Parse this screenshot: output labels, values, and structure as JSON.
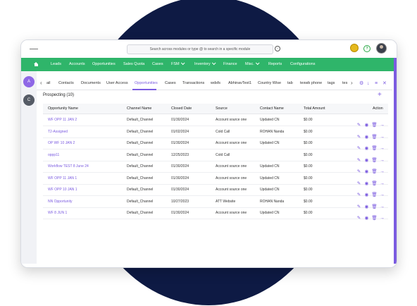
{
  "search": {
    "placeholder": "Search across modules or type @ to search in a specific module"
  },
  "nav": {
    "items": [
      {
        "label": "Leads"
      },
      {
        "label": "Accounts"
      },
      {
        "label": "Opportunities"
      },
      {
        "label": "Sales Quota"
      },
      {
        "label": "Cases"
      },
      {
        "label": "FSM"
      },
      {
        "label": "Inventory"
      },
      {
        "label": "Finance"
      },
      {
        "label": "Misc."
      },
      {
        "label": "Reports"
      },
      {
        "label": "Configurations"
      }
    ]
  },
  "sidebar": {
    "a": "A",
    "c": "C"
  },
  "tabs": [
    {
      "label": "ail"
    },
    {
      "label": "Contacts"
    },
    {
      "label": "Documents"
    },
    {
      "label": "User Access"
    },
    {
      "label": "Opportunities"
    },
    {
      "label": "Cases"
    },
    {
      "label": "Transactions"
    },
    {
      "label": "wdsfs"
    },
    {
      "label": "AbhinavTest1"
    },
    {
      "label": "Country Wise"
    },
    {
      "label": "tab"
    },
    {
      "label": "teswb phone"
    },
    {
      "label": "tags"
    },
    {
      "label": "tes"
    }
  ],
  "section": {
    "title": "Prospecting (10)"
  },
  "table": {
    "headers": [
      "Opportunity Name",
      "Channel Name",
      "Closed Date",
      "Source",
      "Contact Name",
      "Total Amount",
      "Action"
    ],
    "rows": [
      [
        "WF OPP 11 JAN 2",
        "Default_Channel",
        "01/30/2024",
        "Account source one",
        "Updated CN",
        "$0.00"
      ],
      [
        "T2-Assigned",
        "Default_Channel",
        "01/02/2024",
        "Cold Call",
        "ROHAN Nanda",
        "$0.00"
      ],
      [
        "OP WF 10 JAN 2",
        "Default_Channel",
        "01/30/2024",
        "Account source one",
        "Updated CN",
        "$0.00"
      ],
      [
        "oppp11",
        "Default_Channel",
        "12/25/2023",
        "Cold Call",
        "",
        "$0.00"
      ],
      [
        "Workflow TEST 8 June 24",
        "Default_Channel",
        "01/30/2024",
        "Account source one",
        "Updated CN",
        "$0.00"
      ],
      [
        "WF OPP 11 JAN 1",
        "Default_Channel",
        "01/30/2024",
        "Account source one",
        "Updated CN",
        "$0.00"
      ],
      [
        "WF OPP 10 JAN 1",
        "Default_Channel",
        "01/30/2024",
        "Account source one",
        "Updated CN",
        "$0.00"
      ],
      [
        "NN Opportunity",
        "Default_Channel",
        "10/27/2023",
        "ATT Website",
        "ROHAN Nanda",
        "$0.00"
      ],
      [
        "WF 8 JUN 1",
        "Default_Channel",
        "01/30/2024",
        "Account source one",
        "Updated CN",
        "$0.00"
      ]
    ]
  },
  "colors": {
    "accent": "#7b5be0",
    "nav": "#2fb56a",
    "backdrop": "#0e1a44"
  },
  "icons": {
    "row_actions": [
      "edit-icon",
      "view-icon",
      "delete-icon",
      "arrow-right-icon"
    ],
    "tab_tools": [
      "settings-icon",
      "download-icon",
      "list-icon",
      "close-icon"
    ]
  }
}
